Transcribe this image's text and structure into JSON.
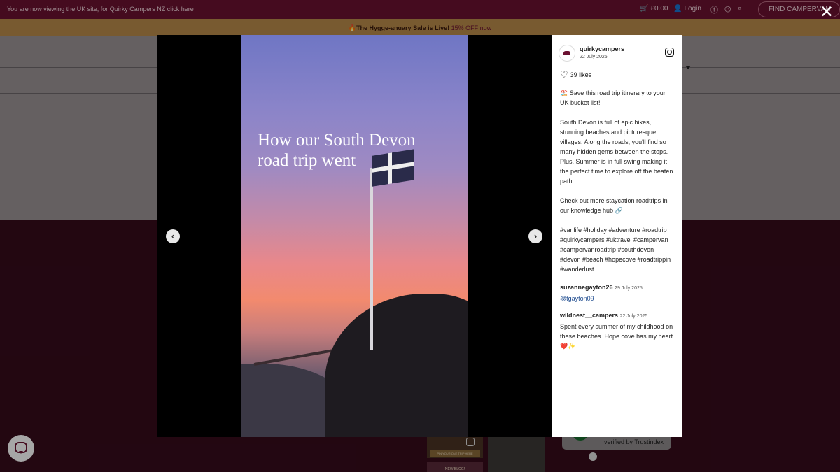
{
  "topbar": {
    "notice": "You are now viewing the UK site, for Quirky Campers NZ click here",
    "cart": "£0.00",
    "login": "Login",
    "find_button": "FIND CAMPERVAN"
  },
  "promo": {
    "emoji": "🔥",
    "title": "The Hygge-anuary Sale is Live!",
    "offer": "15% OFF",
    "suffix": "now"
  },
  "thumbs": {
    "tag1": "PIN YOUR ONE TRIP HERE",
    "tag2": "NEW BLOG!"
  },
  "trust": {
    "label": "verified by Trustindex"
  },
  "modal": {
    "video_text_line1": "How our South Devon",
    "video_text_line2": "road trip went",
    "prev_label": "‹",
    "next_label": "›",
    "close_label": "✕"
  },
  "post": {
    "username": "quirkycampers",
    "date": "22 July 2025",
    "likes": "39 likes",
    "caption": [
      "🏖️ Save this road trip itinerary to your UK bucket list!",
      "South Devon is full of epic hikes, stunning beaches and picturesque villages. Along the roads, you'll find so many hidden gems between the stops. Plus, Summer is in full swing making it the perfect time to explore off the beaten path.",
      "Check out more staycation roadtrips in our knowledge hub 🔗",
      "#vanlife #holiday #adventure #roadtrip #quirkycampers #uktravel #campervan #campervanroadtrip #southdevon #devon #beach #hopecove #roadtrippin #wanderlust"
    ],
    "comments": [
      {
        "user": "suzannegayton26",
        "date": "29 July 2025",
        "text": "@tgayton09"
      },
      {
        "user": "wildnest__campers",
        "date": "22 July 2025",
        "text": "Spent every summer of my childhood on these beaches. Hope cove has my heart ❤️✨"
      }
    ]
  }
}
